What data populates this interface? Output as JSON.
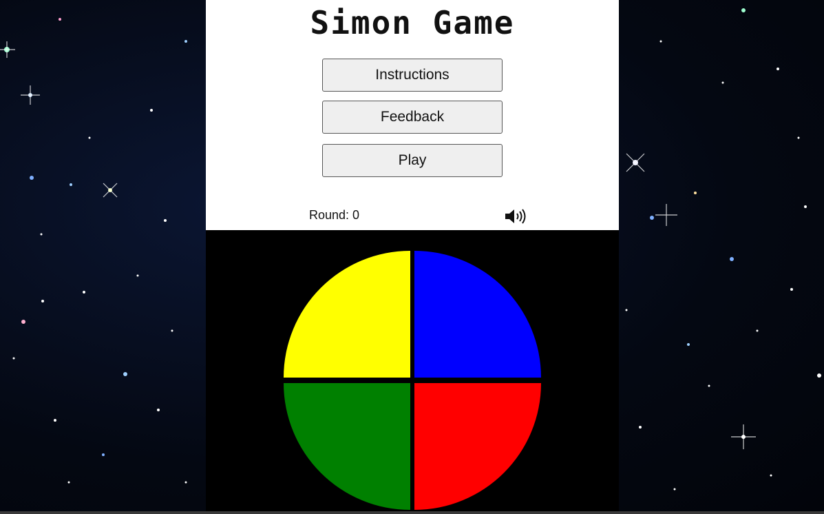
{
  "title": "Simon Game",
  "menu": {
    "instructions_label": "Instructions",
    "feedback_label": "Feedback",
    "play_label": "Play"
  },
  "status": {
    "round_label": "Round: 0",
    "sound_icon": "speaker-volume-icon"
  },
  "board": {
    "pads": [
      {
        "color_name": "yellow",
        "color": "#ffff00"
      },
      {
        "color_name": "blue",
        "color": "#0000ff"
      },
      {
        "color_name": "green",
        "color": "#008000"
      },
      {
        "color_name": "red",
        "color": "#ff0000"
      }
    ],
    "background": "#000000"
  },
  "colors": {
    "panel_bg": "#ffffff",
    "button_bg": "#efefef",
    "page_bg": "#050a1a"
  }
}
